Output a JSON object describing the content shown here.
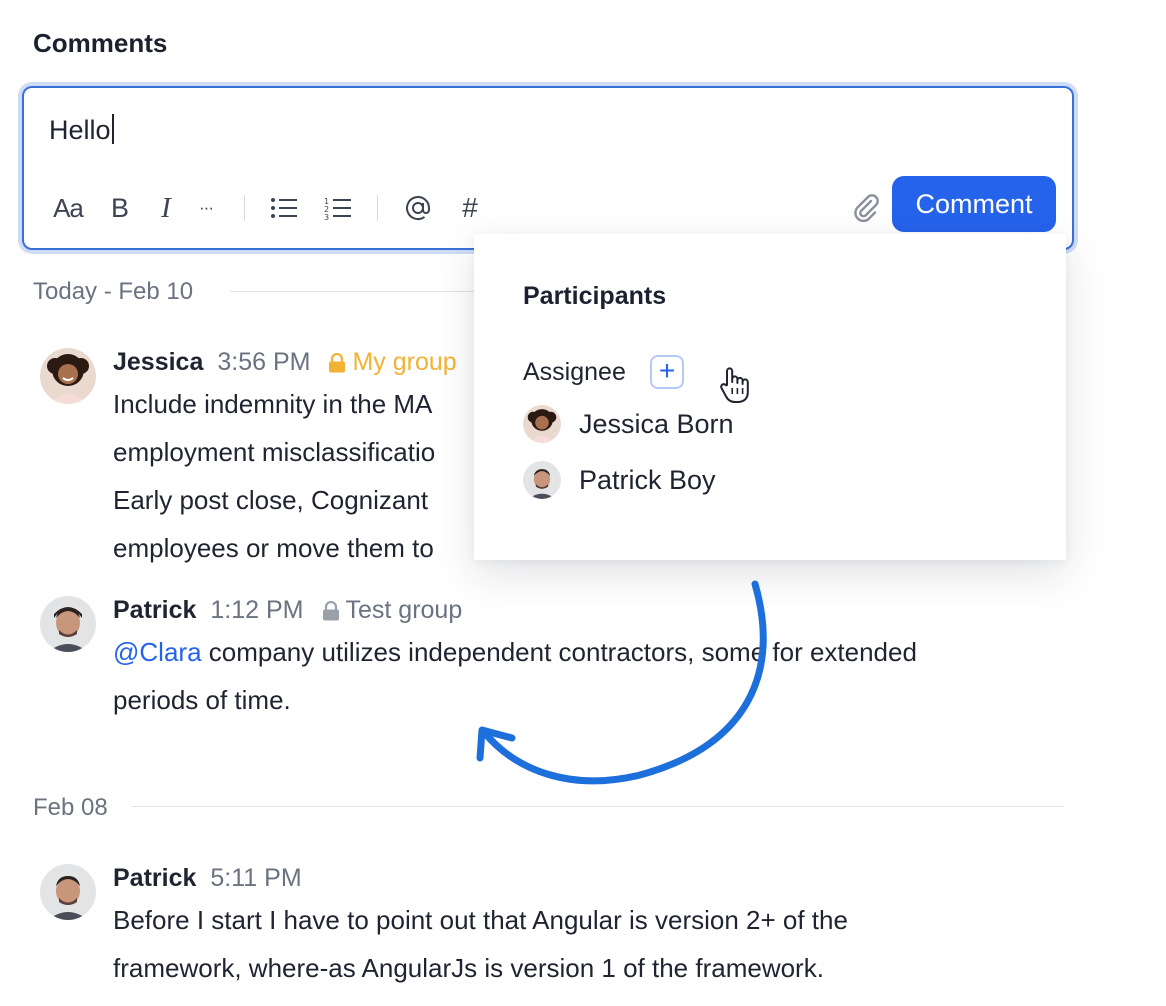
{
  "section_title": "Comments",
  "composer": {
    "value": "Hello",
    "toolbar": {
      "text_style": "Aa",
      "bold": "B",
      "italic": "I",
      "more": "···",
      "hashtag": "#"
    },
    "submit_label": "Comment"
  },
  "days": [
    {
      "label": "Today - Feb 10",
      "comments": [
        {
          "author": "Jessica",
          "time": "3:56 PM",
          "group": "My group",
          "lines": [
            "Include indemnity in the MA",
            "employment misclassificatio",
            "Early post close, Cognizant",
            "employees or move them to"
          ]
        },
        {
          "author": "Patrick",
          "time": "1:12 PM",
          "group": "Test group",
          "mention": "@Clara",
          "line1_rest": " company utilizes independent contractors, some for extended",
          "line2": "periods of time."
        }
      ]
    },
    {
      "label": "Feb 08",
      "comments": [
        {
          "author": "Patrick",
          "time": "5:11 PM",
          "lines": [
            "Before I start I have to point out that Angular is version 2+ of the",
            "framework, where-as AngularJs is version 1 of the framework."
          ]
        }
      ]
    }
  ],
  "participants_popover": {
    "title": "Participants",
    "assignee_label": "Assignee",
    "add_symbol": "+",
    "people": [
      {
        "name": "Jessica Born"
      },
      {
        "name": "Patrick Boy"
      }
    ]
  },
  "colors": {
    "accent": "#2563eb",
    "private_group": "#f2b234",
    "muted_text": "#6b7280"
  }
}
